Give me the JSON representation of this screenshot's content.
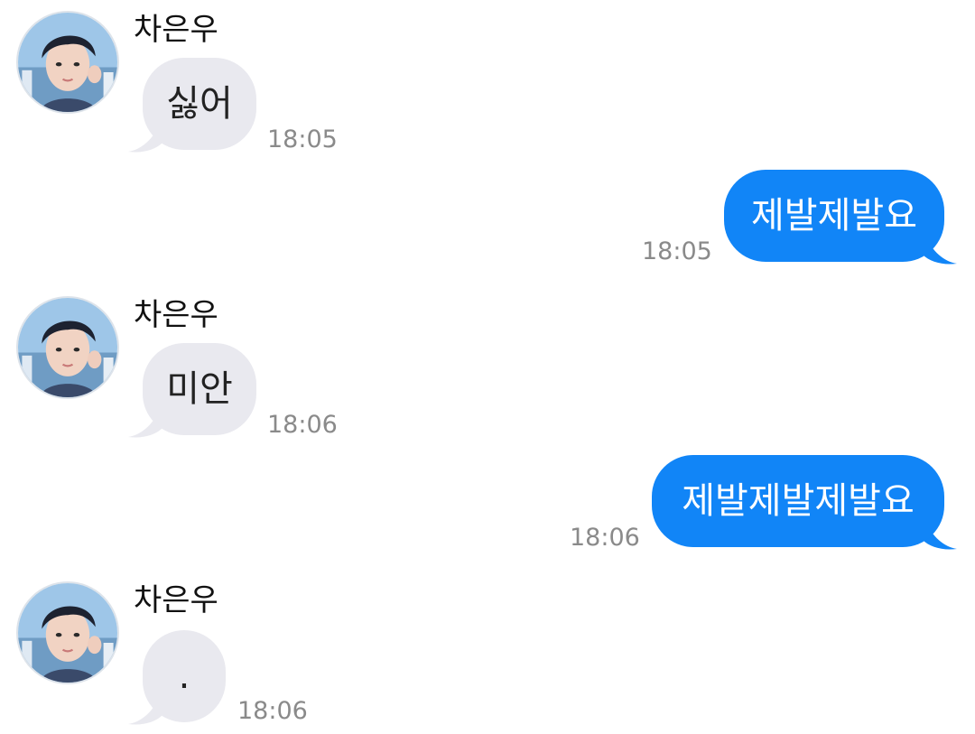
{
  "colors": {
    "incoming_bubble": "#e9e9ef",
    "outgoing_bubble": "#1185f7",
    "timestamp": "#8a8a8a"
  },
  "messages": [
    {
      "direction": "incoming",
      "sender": "차은우",
      "text": "싫어",
      "time": "18:05"
    },
    {
      "direction": "outgoing",
      "text": "제발제발요",
      "time": "18:05"
    },
    {
      "direction": "incoming",
      "sender": "차은우",
      "text": "미안",
      "time": "18:06"
    },
    {
      "direction": "outgoing",
      "text": "제발제발제발요",
      "time": "18:06"
    },
    {
      "direction": "incoming",
      "sender": "차은우",
      "text": ".",
      "time": "18:06"
    }
  ]
}
